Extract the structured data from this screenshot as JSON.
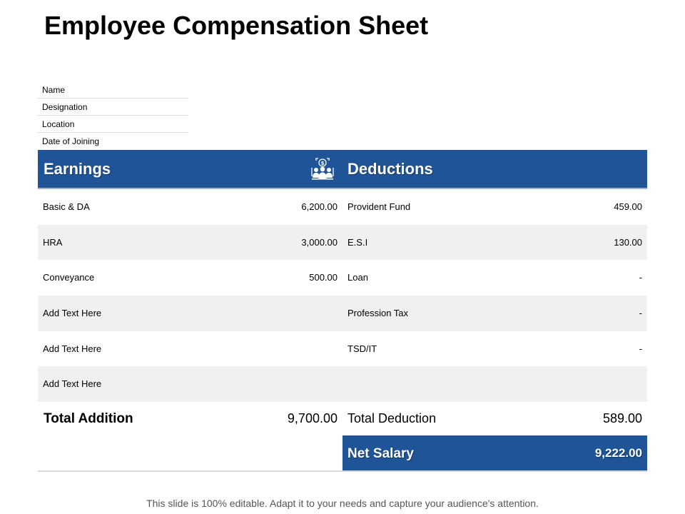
{
  "title": "Employee Compensation Sheet",
  "employee_info": {
    "fields": [
      "Name",
      "Designation",
      "Location",
      "Date  of Joining"
    ]
  },
  "table": {
    "earnings_header": "Earnings",
    "deductions_header": "Deductions",
    "header_icon": "employee-salary-icon",
    "rows": [
      {
        "earning": "Basic & DA",
        "earning_amount": "6,200.00",
        "deduction": "Provident Fund",
        "deduction_amount": "459.00"
      },
      {
        "earning": "HRA",
        "earning_amount": "3,000.00",
        "deduction": "E.S.I",
        "deduction_amount": "130.00"
      },
      {
        "earning": "Conveyance",
        "earning_amount": "500.00",
        "deduction": "Loan",
        "deduction_amount": "-"
      },
      {
        "earning": "Add Text Here",
        "earning_amount": "",
        "deduction": "Profession Tax",
        "deduction_amount": "-"
      },
      {
        "earning": "Add Text Here",
        "earning_amount": "",
        "deduction": "TSD/IT",
        "deduction_amount": "-"
      },
      {
        "earning": "Add Text Here",
        "earning_amount": "",
        "deduction": "",
        "deduction_amount": ""
      }
    ],
    "total_addition_label": "Total Addition",
    "total_addition_value": "9,700.00",
    "total_deduction_label": "Total Deduction",
    "total_deduction_value": "589.00",
    "net_salary_label": "Net Salary",
    "net_salary_value": "9,222.00"
  },
  "footer": "This slide is 100% editable. Adapt it to your needs and capture your audience's attention.",
  "colors": {
    "header_band": "#1f5597",
    "alt_row": "#f0f0f0"
  }
}
